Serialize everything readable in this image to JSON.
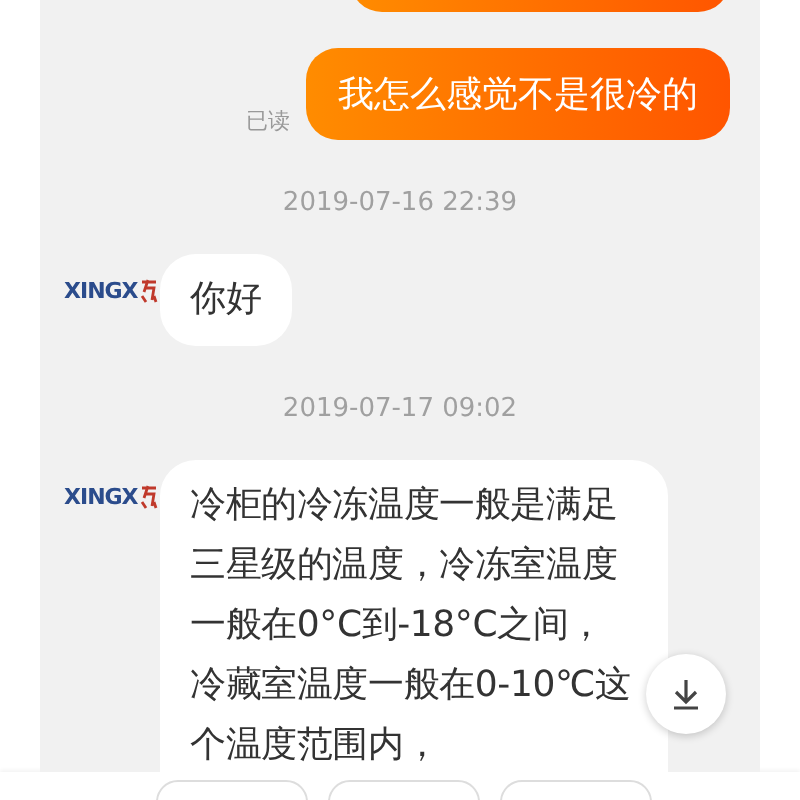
{
  "messages": [
    {
      "kind": "outgoing"
    },
    {
      "kind": "outgoing",
      "text": "我怎么感觉不是很冷的",
      "read_label": "已读"
    },
    {
      "kind": "time",
      "text": "2019-07-16 22:39"
    },
    {
      "kind": "incoming",
      "logo": "XINGX",
      "text": "你好"
    },
    {
      "kind": "time",
      "text": "2019-07-17 09:02"
    },
    {
      "kind": "incoming",
      "logo": "XINGX",
      "text": "冷柜的冷冻温度一般是满足三星级的温度，冷冻室温度一般在0°C到-18°C之间，冷藏室温度一般在0-10℃这个温度范围内，"
    }
  ],
  "quick_replies": [
    {
      "kind": "chip"
    },
    {
      "kind": "chip"
    },
    {
      "kind": "chip"
    }
  ]
}
